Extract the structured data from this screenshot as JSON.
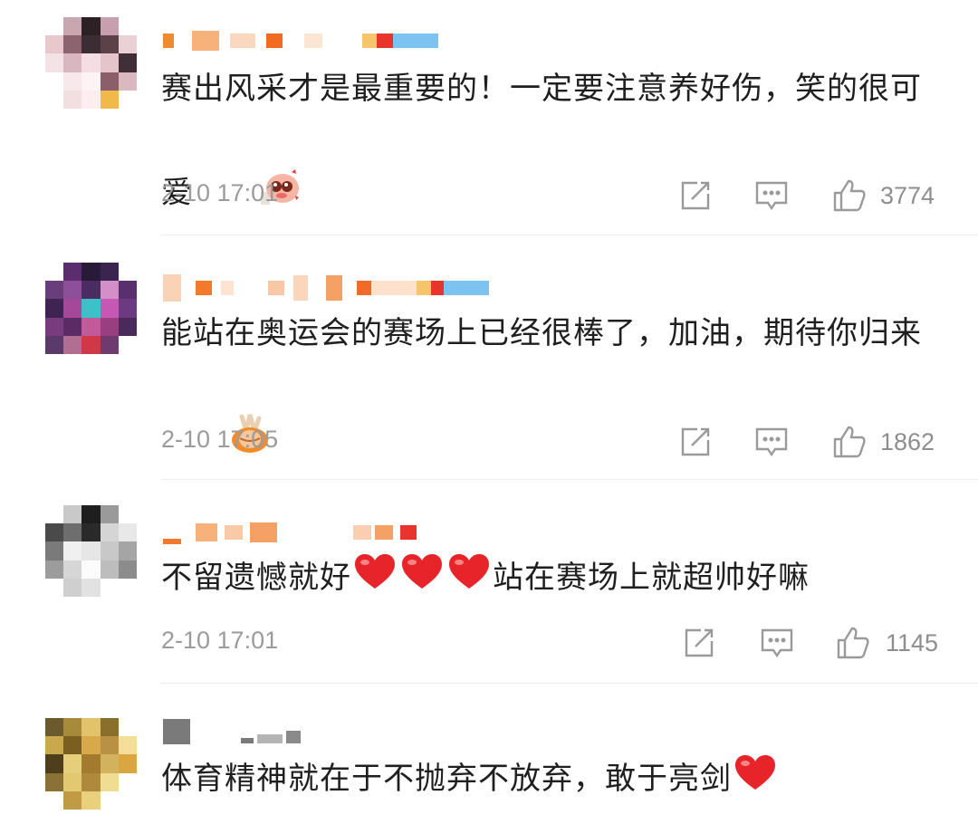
{
  "comments": [
    {
      "text": "赛出风采才是最重要的！一定要注意养好伤，笑的很可爱",
      "emoji": "pig-face-emoji",
      "time": "2-10 17:01",
      "likes": "3774"
    },
    {
      "text": "能站在奥运会的赛场上已经很棒了，加油，期待你归来",
      "emoji": "victory-hands-emoji",
      "time": "2-10 17:05",
      "likes": "1862"
    },
    {
      "text_before": "不留遗憾就好",
      "text_after": "站在赛场上就超帅好嘛",
      "emoji": "red-heart-emoji",
      "time": "2-10 17:01",
      "likes": "1145"
    },
    {
      "text": "体育精神就在于不抛弃不放弃，敢于亮剑",
      "emoji": "red-heart-emoji"
    }
  ],
  "icons": {
    "share": "share-icon",
    "reply": "comment-icon",
    "like": "thumbs-up-icon"
  },
  "colors": {
    "time": "#9b9b9b",
    "icon": "#9a9a9a",
    "heart": "#e8242b"
  }
}
